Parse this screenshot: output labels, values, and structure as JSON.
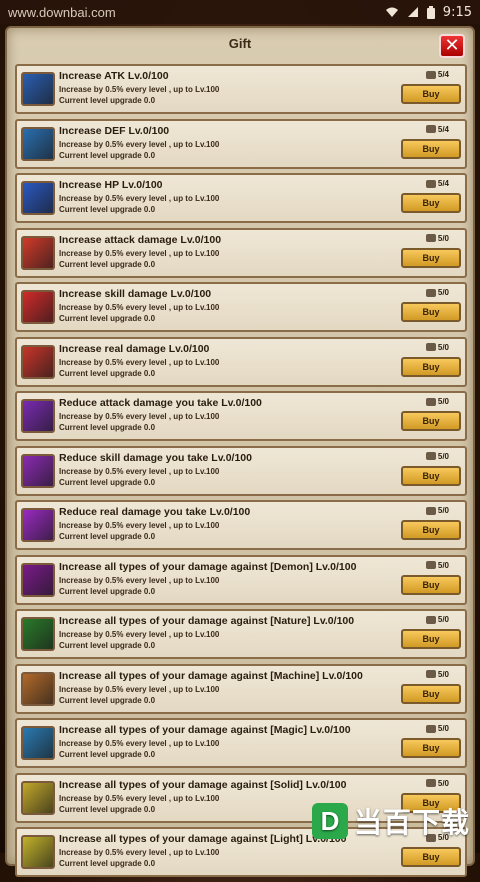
{
  "status_bar": {
    "site": "www.downbai.com",
    "time": "9:15",
    "icons": [
      "wifi-icon",
      "signal-icon",
      "battery-icon"
    ]
  },
  "panel": {
    "title": "Gift",
    "close_label": "✕"
  },
  "buy_label": "Buy",
  "desc_line": "Increase by 0.5% every level , up to Lv.100",
  "current_line": "Current level upgrade 0.0",
  "rows": [
    {
      "title": "Increase ATK Lv.0/100",
      "cost": "5/4",
      "icon": "atk-icon",
      "color": "#2a5fb2"
    },
    {
      "title": "Increase DEF Lv.0/100",
      "cost": "5/4",
      "icon": "def-icon",
      "color": "#2a6fb2"
    },
    {
      "title": "Increase HP Lv.0/100",
      "cost": "5/4",
      "icon": "hp-icon",
      "color": "#2a58c2"
    },
    {
      "title": "Increase attack damage Lv.0/100",
      "cost": "5/0",
      "icon": "attack-damage-icon",
      "color": "#d13a2a"
    },
    {
      "title": "Increase skill damage Lv.0/100",
      "cost": "5/0",
      "icon": "skill-damage-icon",
      "color": "#d12a2a"
    },
    {
      "title": "Increase real damage Lv.0/100",
      "cost": "5/0",
      "icon": "real-damage-icon",
      "color": "#c7352a"
    },
    {
      "title": "Reduce attack damage you take Lv.0/100",
      "cost": "5/0",
      "icon": "reduce-attack-icon",
      "color": "#7a2ab2"
    },
    {
      "title": "Reduce skill damage you take Lv.0/100",
      "cost": "5/0",
      "icon": "reduce-skill-icon",
      "color": "#8a2ab2"
    },
    {
      "title": "Reduce real damage you take Lv.0/100",
      "cost": "5/0",
      "icon": "reduce-real-icon",
      "color": "#9a2ac2"
    },
    {
      "title": "Increase all types of your damage against [Demon] Lv.0/100",
      "cost": "5/0",
      "icon": "demon-icon",
      "color": "#7a1a8a"
    },
    {
      "title": "Increase all types of your damage against [Nature] Lv.0/100",
      "cost": "5/0",
      "icon": "nature-icon",
      "color": "#2a7a2a"
    },
    {
      "title": "Increase all types of your damage against [Machine] Lv.0/100",
      "cost": "5/0",
      "icon": "machine-icon",
      "color": "#b26a2a"
    },
    {
      "title": "Increase all types of your damage against [Magic] Lv.0/100",
      "cost": "5/0",
      "icon": "magic-icon",
      "color": "#2a7ab2"
    },
    {
      "title": "Increase all types of your damage against [Solid] Lv.0/100",
      "cost": "5/0",
      "icon": "solid-icon",
      "color": "#c2a82a"
    },
    {
      "title": "Increase all types of your damage against [Light] Lv.0/100",
      "cost": "5/0",
      "icon": "light-icon",
      "color": "#c2b22a"
    }
  ],
  "watermark": {
    "badge": "D",
    "text": "当百下载"
  }
}
